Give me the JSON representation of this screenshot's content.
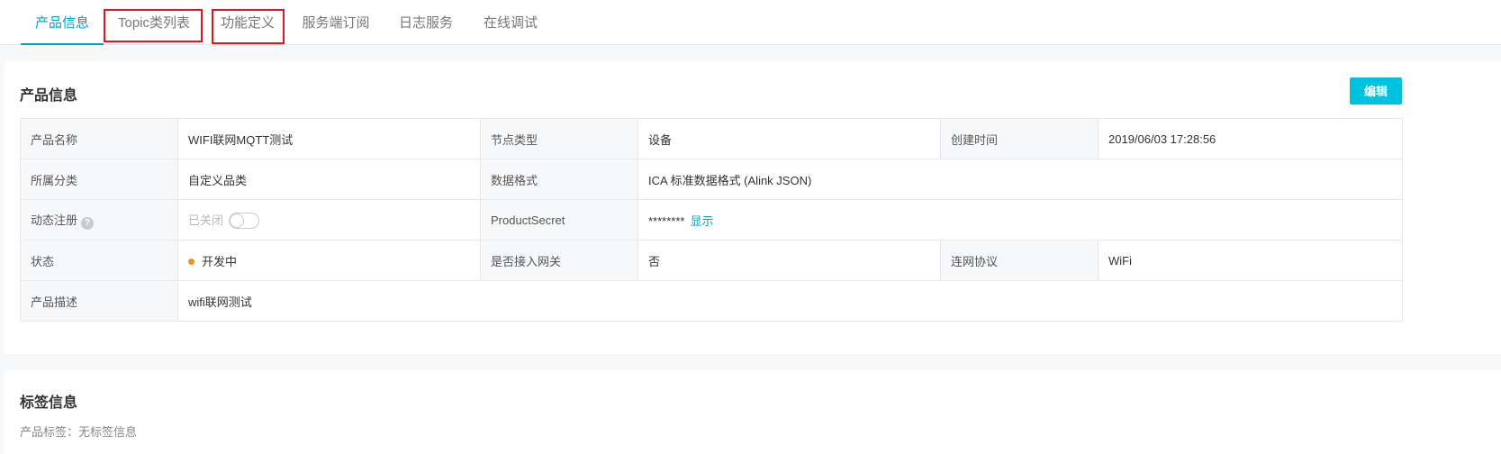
{
  "tabs": [
    {
      "label": "产品信息",
      "active": true
    },
    {
      "label": "Topic类列表",
      "active": false
    },
    {
      "label": "功能定义",
      "active": false
    },
    {
      "label": "服务端订阅",
      "active": false
    },
    {
      "label": "日志服务",
      "active": false
    },
    {
      "label": "在线调试",
      "active": false
    }
  ],
  "product_info": {
    "title": "产品信息",
    "edit_label": "编辑",
    "rows": {
      "name": {
        "label": "产品名称",
        "value": "WIFI联网MQTT测试"
      },
      "node_type": {
        "label": "节点类型",
        "value": "设备"
      },
      "created": {
        "label": "创建时间",
        "value": "2019/06/03 17:28:56"
      },
      "category": {
        "label": "所属分类",
        "value": "自定义品类"
      },
      "data_format": {
        "label": "数据格式",
        "value": "ICA 标准数据格式 (Alink JSON)"
      },
      "dynamic_reg": {
        "label": "动态注册",
        "help": "?",
        "value": "已关闭"
      },
      "secret": {
        "label": "ProductSecret",
        "value": "********",
        "show_label": "显示"
      },
      "status": {
        "label": "状态",
        "value": "开发中"
      },
      "gateway": {
        "label": "是否接入网关",
        "value": "否"
      },
      "protocol": {
        "label": "连网协议",
        "value": "WiFi"
      },
      "description": {
        "label": "产品描述",
        "value": "wifi联网测试"
      }
    }
  },
  "tags_section": {
    "title": "标签信息",
    "line": "产品标签：无标签信息"
  },
  "colors": {
    "accent": "#00a2ca",
    "button": "#00c1de",
    "status_dot": "#f98e1a",
    "highlight_box": "#e0161f"
  }
}
